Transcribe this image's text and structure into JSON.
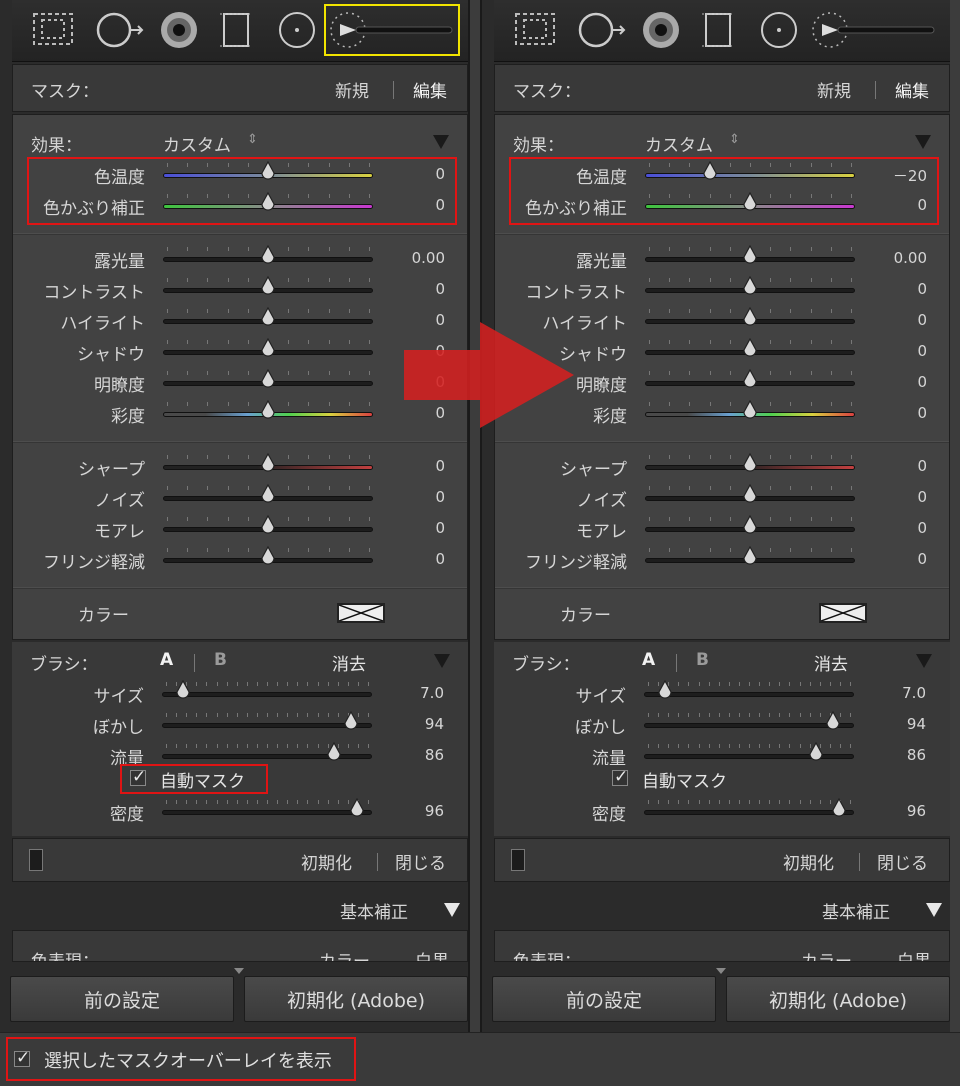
{
  "toolbar": {
    "icons": [
      "crop-icon",
      "spot-removal-icon",
      "red-eye-icon",
      "graduated-filter-icon",
      "radial-filter-icon",
      "adjustment-brush-icon"
    ]
  },
  "mask": {
    "label": "マスク：",
    "new": "新規",
    "edit": "編集"
  },
  "effect": {
    "label": "効果：",
    "value": "カスタム"
  },
  "sliders_group1": [
    {
      "label": "色温度",
      "left_value": "0",
      "right_value": "－20",
      "left_pos": 0.5,
      "right_pos": 0.31,
      "gradient": "temp"
    },
    {
      "label": "色かぶり補正",
      "left_value": "0",
      "right_value": "0",
      "left_pos": 0.5,
      "right_pos": 0.5,
      "gradient": "tint"
    }
  ],
  "sliders_group2": [
    {
      "label": "露光量",
      "value": "0.00",
      "pos": 0.5
    },
    {
      "label": "コントラスト",
      "value": "0",
      "pos": 0.5
    },
    {
      "label": "ハイライト",
      "value": "0",
      "pos": 0.5
    },
    {
      "label": "シャドウ",
      "value": "0",
      "pos": 0.5
    },
    {
      "label": "明瞭度",
      "value": "0",
      "pos": 0.5
    },
    {
      "label": "彩度",
      "value": "0",
      "pos": 0.5,
      "gradient": "sat"
    }
  ],
  "sliders_group3": [
    {
      "label": "シャープ",
      "value": "0",
      "pos": 0.5,
      "gradient": "sharp"
    },
    {
      "label": "ノイズ",
      "value": "0",
      "pos": 0.5
    },
    {
      "label": "モアレ",
      "value": "0",
      "pos": 0.5
    },
    {
      "label": "フリンジ軽減",
      "value": "0",
      "pos": 0.5
    }
  ],
  "color": {
    "label": "カラー"
  },
  "brush": {
    "label": "ブラシ：",
    "a": "A",
    "b": "B",
    "erase": "消去",
    "sliders": [
      {
        "label": "サイズ",
        "value": "7.0",
        "pos": 0.1
      },
      {
        "label": "ぼかし",
        "value": "94",
        "pos": 0.9
      },
      {
        "label": "流量",
        "value": "86",
        "pos": 0.82
      }
    ],
    "automask": "自動マスク",
    "density": {
      "label": "密度",
      "value": "96",
      "pos": 0.93
    }
  },
  "footer": {
    "reset": "初期化",
    "close": "閉じる"
  },
  "basic": {
    "label": "基本補正"
  },
  "treatment": {
    "label": "色表現：",
    "color": "カラー",
    "bw": "白黒"
  },
  "buttons": {
    "previous": "前の設定",
    "reset_adobe": "初期化 (Adobe)"
  },
  "bottom": {
    "overlay_label": "選択したマスクオーバーレイを表示"
  },
  "colors": {
    "highlight_red": "#e01414",
    "active_tool": "#f2e400",
    "arrow": "#d42020"
  }
}
